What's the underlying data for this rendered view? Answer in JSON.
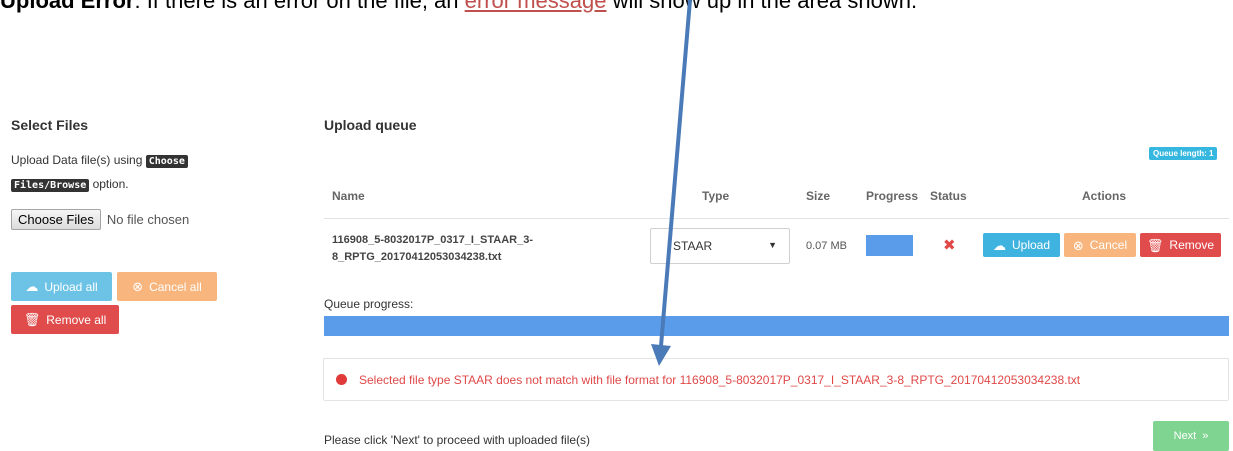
{
  "caption": {
    "bold_part": "Upload Error",
    "text_part": ": If there is an error on the file, an ",
    "link_part": "error message",
    "tail_part": " will show up in the area shown."
  },
  "left": {
    "title": "Select Files",
    "desc_prefix": "Upload Data file(s) using ",
    "desc_kbd1": "Choose",
    "desc_kbd2": "Files/Browse",
    "desc_suffix": " option.",
    "choose_files_label": "Choose Files",
    "no_file_text": "No file chosen",
    "upload_all_label": "Upload all",
    "cancel_all_label": "Cancel all",
    "remove_all_label": "Remove all"
  },
  "queue": {
    "title": "Upload queue",
    "badge": "Queue length: 1",
    "columns": [
      "Name",
      "Type",
      "Size",
      "Progress",
      "Status",
      "Actions"
    ],
    "row": {
      "name": "116908_5-8032017P_0317_I_STAAR_3-8_RPTG_20170412053034238.txt",
      "type": "STAAR",
      "size": "0.07 MB",
      "progress": 1.0,
      "status_icon": "error-x-icon",
      "upload_label": "Upload",
      "cancel_label": "Cancel",
      "remove_label": "Remove"
    },
    "progress_label": "Queue progress:",
    "queue_progress": 1.0,
    "error_message": "Selected file type STAAR does not match with file format for 116908_5-8032017P_0317_I_STAAR_3-8_RPTG_20170412053034238.txt",
    "footer_text": "Please click 'Next' to proceed with uploaded file(s)",
    "next_label": "Next"
  },
  "colors": {
    "primary": "#5b9cea",
    "info": "#3fb3e0",
    "warning": "#f8b57d",
    "danger": "#e04b4b",
    "success": "#7fd491",
    "arrow": "#4a7ab8"
  }
}
